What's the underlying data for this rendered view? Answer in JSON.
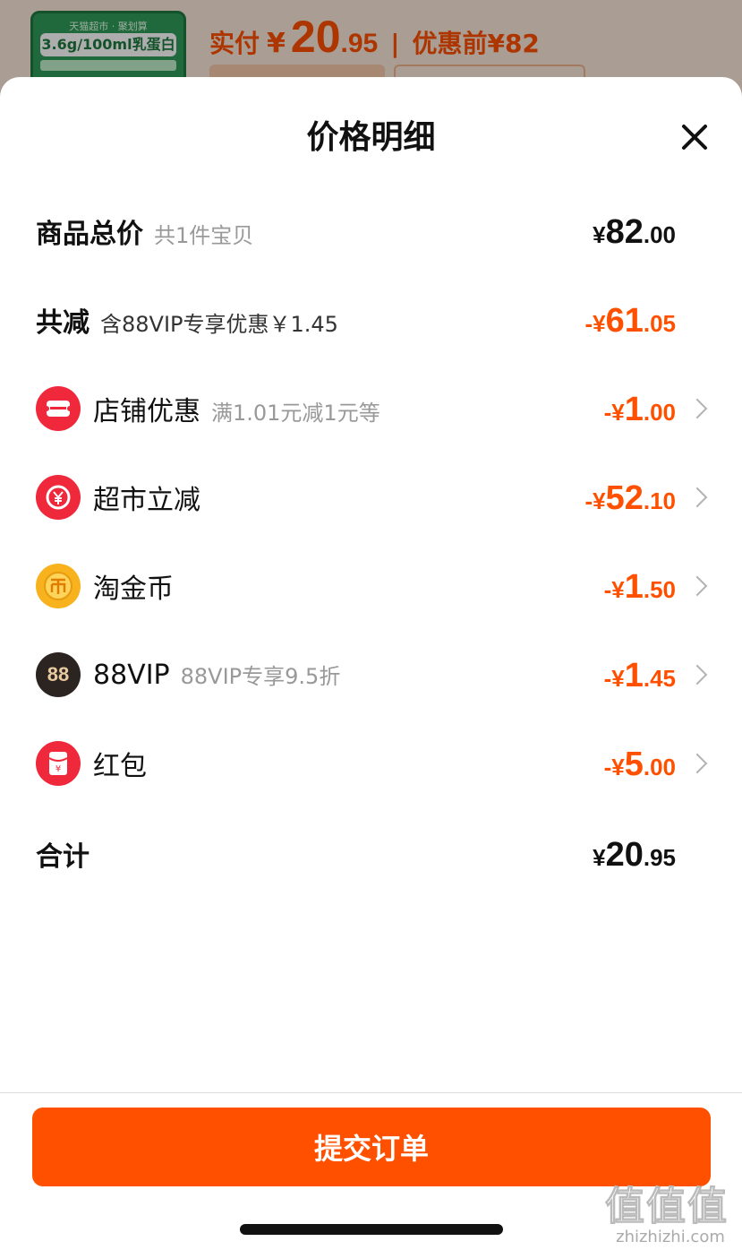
{
  "background": {
    "product_brand": "天猫超市 · 聚划算",
    "product_text": "3.6g/100ml乳蛋白",
    "price_label": "实付",
    "price_currency": "¥",
    "price_int": "20",
    "price_dec": ".95",
    "separator": "|",
    "original_label": "优惠前¥82"
  },
  "sheet": {
    "title": "价格明细",
    "close_icon": "close-icon"
  },
  "rows": {
    "total": {
      "label": "商品总价",
      "sub": "共1件宝贝",
      "currency": "¥",
      "int": "82",
      "dec": ".00"
    },
    "discount": {
      "label": "共减",
      "sub": "含88VIP专享优惠￥1.45",
      "currency": "-¥",
      "int": "61",
      "dec": ".05"
    },
    "shop": {
      "icon": "shop-coupon-icon",
      "label": "店铺优惠",
      "sub": "满1.01元减1元等",
      "currency": "-¥",
      "int": "1",
      "dec": ".00"
    },
    "supermarket": {
      "icon": "yuan-refund-icon",
      "label": "超市立减",
      "sub": "",
      "currency": "-¥",
      "int": "52",
      "dec": ".10"
    },
    "coins": {
      "icon": "gold-coin-icon",
      "label": "淘金币",
      "sub": "",
      "currency": "-¥",
      "int": "1",
      "dec": ".50"
    },
    "vip": {
      "icon": "88vip-icon",
      "icon_text": "88",
      "label": "88VIP",
      "sub": "88VIP专享9.5折",
      "currency": "-¥",
      "int": "1",
      "dec": ".45"
    },
    "redpacket": {
      "icon": "red-packet-icon",
      "label": "红包",
      "sub": "",
      "currency": "-¥",
      "int": "5",
      "dec": ".00"
    },
    "sum": {
      "label": "合计",
      "currency": "¥",
      "int": "20",
      "dec": ".95"
    }
  },
  "footer": {
    "submit_label": "提交订单",
    "watermark": "值值值",
    "watermark_url": "zhizhizhi.com"
  },
  "colors": {
    "accent": "#ff5000",
    "shop_icon": "#f0283c",
    "coin_icon": "#f7b21e",
    "vip_icon": "#2b2421"
  }
}
